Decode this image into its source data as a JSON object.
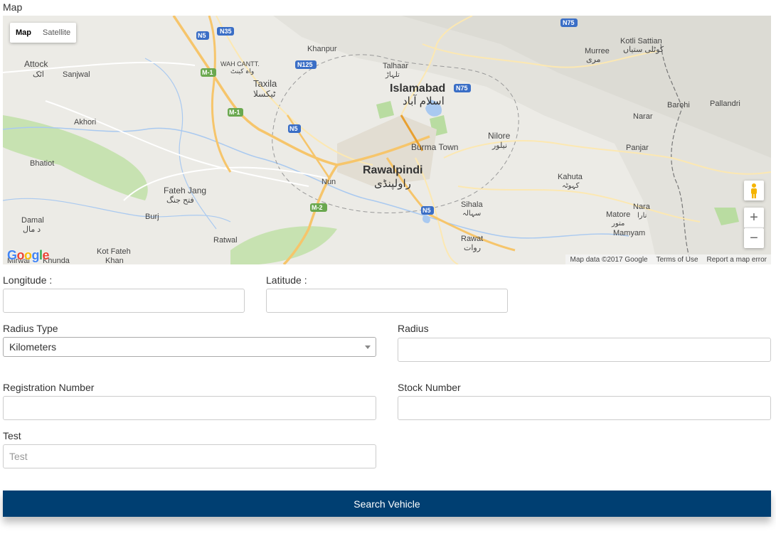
{
  "map_section": {
    "title": "Map",
    "map_type": {
      "map": "Map",
      "satellite": "Satellite",
      "active": "Map"
    },
    "logo_text": "Google",
    "attribution": [
      "Map data ©2017 Google",
      "Terms of Use",
      "Report a map error"
    ],
    "places": [
      {
        "label": "Attock",
        "sub": "اٹک"
      },
      {
        "label": "Sanjwal"
      },
      {
        "label": "Akhori"
      },
      {
        "label": "Bhatiot"
      },
      {
        "label": "Damal",
        "sub": "د مال"
      },
      {
        "label": "Mirwal"
      },
      {
        "label": "Khunda"
      },
      {
        "label": "Kot Fateh",
        "sub": "Khan"
      },
      {
        "label": "Fateh Jang",
        "sub": "فتح جنگ"
      },
      {
        "label": "Burj"
      },
      {
        "label": "Ratwal"
      },
      {
        "label": "Taxila",
        "sub": "ٹیکسلا"
      },
      {
        "label": "WAH CANTT.",
        "sub": "واہ کینٹ"
      },
      {
        "label": "Khanpur"
      },
      {
        "label": "Talhaar",
        "sub": "تلہاڑ"
      },
      {
        "label": "Islamabad",
        "sub": "اسلام آباد"
      },
      {
        "label": "Rawalpindi",
        "sub": "راولپنڈی"
      },
      {
        "label": "Nun"
      },
      {
        "label": "Burma Town"
      },
      {
        "label": "Nilore",
        "sub": "نیلور"
      },
      {
        "label": "Sihala",
        "sub": "سہالہ"
      },
      {
        "label": "Rawat",
        "sub": "روات"
      },
      {
        "label": "Kahuta",
        "sub": "کہوٹہ"
      },
      {
        "label": "Murree",
        "sub": "مری"
      },
      {
        "label": "Kotli Sattian",
        "sub": "کوٹلی ستیاں"
      },
      {
        "label": "Narar"
      },
      {
        "label": "Panjar"
      },
      {
        "label": "Barohi"
      },
      {
        "label": "Pallandri"
      },
      {
        "label": "Matore",
        "sub": "متور"
      },
      {
        "label": "Nara",
        "sub": "نارا"
      },
      {
        "label": "Mamyam"
      }
    ],
    "road_shields": [
      "N35",
      "N5",
      "M-1",
      "N125",
      "N75",
      "M-2"
    ]
  },
  "form": {
    "longitude": {
      "label": "Longitude :",
      "value": "",
      "placeholder": ""
    },
    "latitude": {
      "label": "Latitude :",
      "value": "",
      "placeholder": ""
    },
    "radius_type": {
      "label": "Radius Type",
      "selected": "Kilometers"
    },
    "radius": {
      "label": "Radius",
      "value": ""
    },
    "registration_number": {
      "label": "Registration Number",
      "value": ""
    },
    "stock_number": {
      "label": "Stock Number",
      "value": ""
    },
    "test": {
      "label": "Test",
      "placeholder": "Test",
      "value": ""
    },
    "submit_label": "Search Vehicle"
  },
  "colors": {
    "button_bg": "#003f72",
    "map_land": "#ecebe6",
    "map_water": "#a9c9f0",
    "map_park": "#c7e2b1",
    "map_highway": "#f6c56b"
  }
}
